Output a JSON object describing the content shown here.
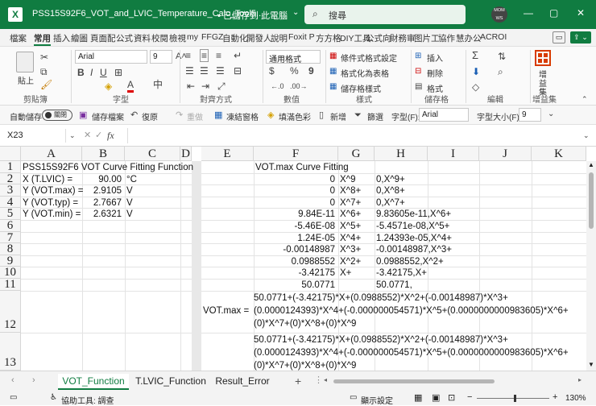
{
  "titlebar": {
    "app_icon": "excel-icon",
    "filename": "PSS15S92F6_VOT_and_LVIC_Temperature_Calc_Tool5...",
    "save_status": "• 已儲存到 此電腦",
    "search_placeholder": "搜尋",
    "avatar_text": "MOM\nWS",
    "minimize": "—",
    "restore": "▢",
    "close": "✕"
  },
  "menu_tabs": [
    "檔案",
    "常用",
    "插入",
    "繪圖",
    "頁面配",
    "公式",
    "資料",
    "校閱",
    "檢視",
    "my",
    "FFGZ",
    "自動化",
    "開發人",
    "說明",
    "Foxit P",
    "方方格",
    "DIY工具",
    "公式向",
    "財務审",
    "图片工",
    "協作",
    "慧办公",
    "ACROI"
  ],
  "active_tab": "常用",
  "ribbon": {
    "paste": "貼上",
    "font_name": "Arial",
    "font_size": "9",
    "number_format": "通用格式",
    "cond_format": "條件式格式設定",
    "table_format": "格式化為表格",
    "cell_styles": "儲存格樣式",
    "insert": "插入",
    "delete": "刪除",
    "format": "格式",
    "sum_edit": "Σ",
    "addins": "增益集",
    "groups": {
      "clipboard": "剪貼簿",
      "font": "字型",
      "alignment": "對齊方式",
      "number": "數值",
      "styles": "樣式",
      "cells": "儲存格",
      "editing": "編輯",
      "addins": "增益集"
    }
  },
  "qat": {
    "autosave": "自動儲存",
    "toggle_state": "關閉",
    "save_file": "儲存檔案",
    "undo": "復原",
    "redo": "重做",
    "freeze": "凍結窗格",
    "fill_color": "填滿色彩",
    "new": "新增",
    "filter": "篩選",
    "font_label": "字型(F):",
    "font_value": "Arial",
    "size_label": "字型大小(F):",
    "size_value": "9"
  },
  "formula_bar": {
    "name_box": "X23",
    "fx": "fx",
    "content": ""
  },
  "columns": [
    "A",
    "B",
    "C",
    "D",
    "E",
    "F",
    "G",
    "H",
    "I",
    "J",
    "K"
  ],
  "rows": [
    "1",
    "2",
    "3",
    "4",
    "5",
    "6",
    "7",
    "8",
    "9",
    "10",
    "11",
    "12",
    "13"
  ],
  "cells": {
    "A1": "PSS15S92F6 VOT Curve Fitting Function",
    "A2": "X (T.LVIC) =",
    "B2": "90.00",
    "C2": "°C",
    "A3": "Y (VOT.max) =",
    "B3": "2.9105",
    "C3": "V",
    "A4": "Y (VOT.typ) =",
    "B4": "2.7667",
    "C4": "V",
    "A5": "Y (VOT.min) =",
    "B5": "2.6321",
    "C5": "V",
    "F1": "VOT.max Curve Fitting",
    "F2": "0",
    "G2": "X^9",
    "H2": "0,X^9+",
    "F3": "0",
    "G3": "X^8+",
    "H3": "0,X^8+",
    "F4": "0",
    "G4": "X^7+",
    "H4": "0,X^7+",
    "F5": "9.84E-11",
    "G5": "X^6+",
    "H5": "9.83605e-11,X^6+",
    "F6": "-5.46E-08",
    "G6": "X^5+",
    "H6": "-5.4571e-08,X^5+",
    "F7": "1.24E-05",
    "G7": "X^4+",
    "H7": "1.24393e-05,X^4+",
    "F8": "-0.00148987",
    "G8": "X^3+",
    "H8": "-0.00148987,X^3+",
    "F9": "0.0988552",
    "G9": "X^2+",
    "H9": "0.0988552,X^2+",
    "F10": "-3.42175",
    "G10": "X+",
    "H10": "-3.42175,X+",
    "F11": "50.0771",
    "H11": "50.0771,",
    "E12": "VOT.max =",
    "F12": "50.0771+(-3.42175)*X+(0.0988552)*X^2+(-0.00148987)*X^3+(0.0000124393)*X^4+(-0.000000054571)*X^5+(0.0000000000983605)*X^6+(0)*X^7+(0)*X^8+(0)*X^9",
    "F13": "50.0771+(-3.42175)*X+(0.0988552)*X^2+(-0.00148987)*X^3+(0.0000124393)*X^4+(-0.000000054571)*X^5+(0.0000000000983605)*X^6+(0)*X^7+(0)*X^8+(0)*X^9"
  },
  "sheet_tabs": [
    "VOT_Function",
    "T.LVIC_Function",
    "Result_Error"
  ],
  "active_sheet": "VOT_Function",
  "add_sheet": "+",
  "status": {
    "ready_icon": "sheet-icon",
    "accessibility": "協助工具: 調查",
    "display_settings": "顯示設定",
    "zoom": "130%",
    "zoom_minus": "−",
    "zoom_plus": "+"
  },
  "colors": {
    "title_green": "#107c41",
    "accent": "#107c41"
  }
}
